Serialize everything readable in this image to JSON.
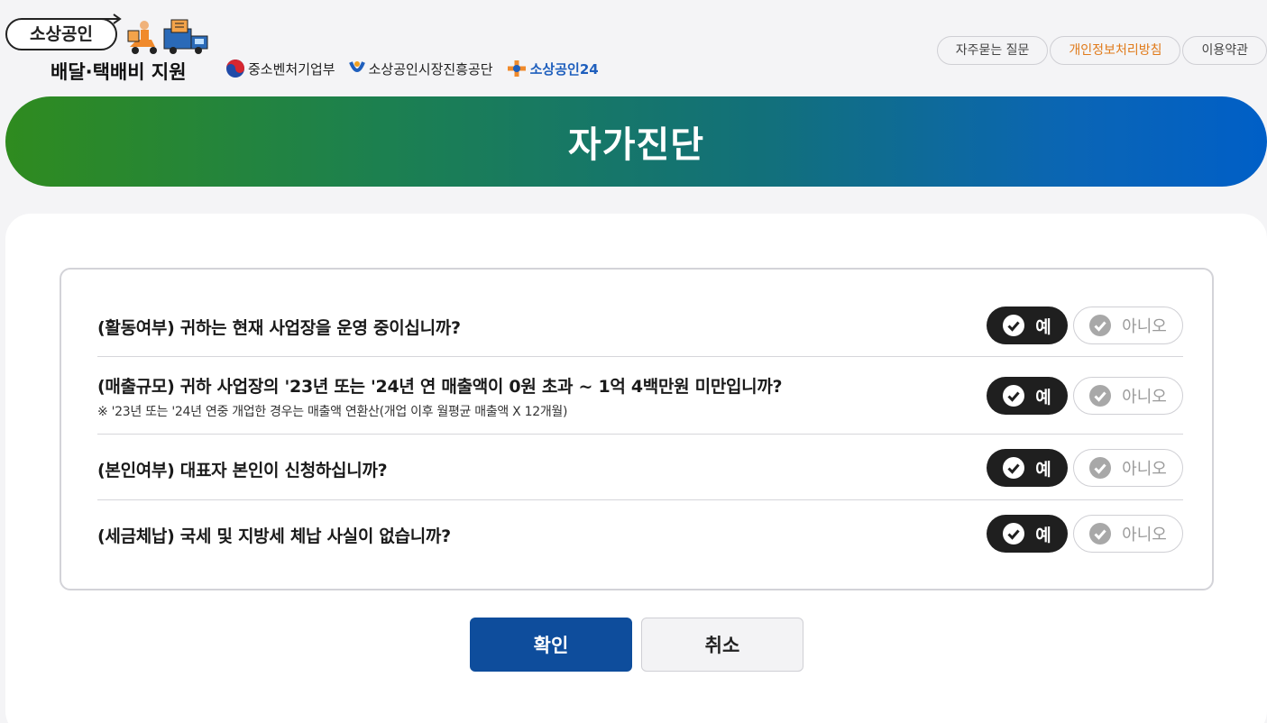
{
  "header": {
    "logo_top": "소상공인",
    "logo_sub": "배달·택배비 지원",
    "partners": [
      "중소벤처기업부",
      "소상공인시장진흥공단",
      "소상공인24"
    ],
    "links": [
      "자주묻는 질문",
      "개인정보처리방침",
      "이용약관"
    ]
  },
  "banner": {
    "title": "자가진단"
  },
  "questions": [
    {
      "text": "(활동여부) 귀하는 현재 사업장을 운영 중이십니까?",
      "note": "",
      "selected": "yes"
    },
    {
      "text": "(매출규모) 귀하 사업장의 '23년 또는 '24년 연 매출액이 0원 초과 ~ 1억 4백만원 미만입니까?",
      "note": "※ '23년 또는 '24년 연중 개업한 경우는 매출액 연환산(개업 이후 월평균 매출액 X 12개월)",
      "selected": "yes"
    },
    {
      "text": "(본인여부) 대표자 본인이 신청하십니까?",
      "note": "",
      "selected": "yes"
    },
    {
      "text": "(세금체납) 국세 및 지방세 체납 사실이 없습니까?",
      "note": "",
      "selected": "yes"
    }
  ],
  "answers": {
    "yes": "예",
    "no": "아니오"
  },
  "actions": {
    "confirm": "확인",
    "cancel": "취소"
  },
  "colors": {
    "brand_blue": "#0e4d9c",
    "banner_start": "#2f8b1f",
    "banner_end": "#005fc7",
    "highlight_link": "#e07a1a"
  }
}
